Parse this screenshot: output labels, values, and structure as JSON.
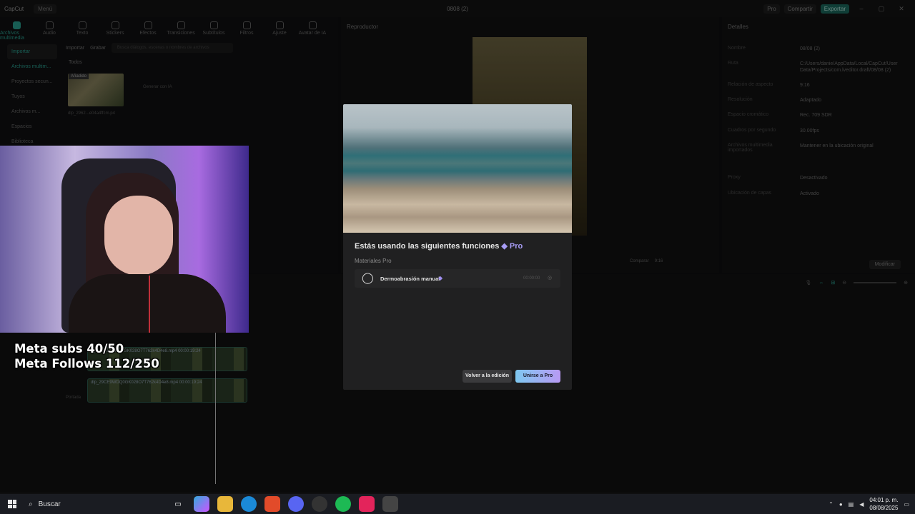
{
  "titlebar": {
    "logo": "CapCut",
    "menu": "Menú",
    "title": "0808 (2)",
    "pro": "Pro",
    "share": "Compartir",
    "export": "Exportar"
  },
  "tools": [
    "Archivos multimedia",
    "Audio",
    "Texto",
    "Stickers",
    "Efectos",
    "Transiciones",
    "Subtítulos",
    "Filtros",
    "Ajuste",
    "Avatar de IA"
  ],
  "sidebar": [
    "Importar",
    "Archivos multim...",
    "Proyectos secun...",
    "Tuyos",
    "Archivos m...",
    "Espacios",
    "Biblioteca"
  ],
  "media": {
    "import": "Importar",
    "record": "Grabar",
    "search_placeholder": "Busca diálogos, escenas o nombres de archivos",
    "all": "Todos",
    "added": "Añadido",
    "thumb_label": "dlp_2962...e04a4ffcm.p4",
    "gen_ai": "Generar con IA"
  },
  "player": {
    "title": "Reproductor",
    "compare": "Comparar",
    "ratio": "9:16"
  },
  "details": {
    "title": "Detalles",
    "rows": [
      {
        "k": "Nombre",
        "v": "08/08 (2)"
      },
      {
        "k": "Ruta",
        "v": "C:/Users/danie/AppData/Local/CapCut/User Data/Projects/com.lveditor.draft/08/08 (2)"
      },
      {
        "k": "Relación de aspecto",
        "v": "9:16"
      },
      {
        "k": "Resolución",
        "v": "Adaptado"
      },
      {
        "k": "Espacio cromático",
        "v": "Rec. 709 SDR"
      },
      {
        "k": "Cuadros por segundo",
        "v": "30.00fps"
      },
      {
        "k": "Archivos multimedia importados",
        "v": "Mantener en la ubicación original"
      },
      {
        "k": "Proxy",
        "v": "Desactivado"
      },
      {
        "k": "Ubicación de capas",
        "v": "Activado"
      }
    ],
    "modify": "Modificar"
  },
  "timeline": {
    "clip1": "dlp_29CE9VDQ0GK028O7T762k4D4e8.mp4  00:00:19:24",
    "clip2": "dlp_29CE9WDQ0GK028O7T762k4D4e8.mp4  00:00:19:24",
    "cover": "Portada"
  },
  "overlay": {
    "line1": "Meta subs 40/50",
    "line2": "Meta Follows 112/250"
  },
  "modal": {
    "title_prefix": "Estás usando las siguientes funciones",
    "title_pro": "Pro",
    "section": "Materiales Pro",
    "feature": "Dermoabrasión manual",
    "feature_time": "00:00:00",
    "back_button": "Volver a la edición",
    "join_button": "Unirse a Pro"
  },
  "taskbar": {
    "search": "Buscar",
    "time": "04:01 p. m.",
    "date": "08/08/2025"
  }
}
